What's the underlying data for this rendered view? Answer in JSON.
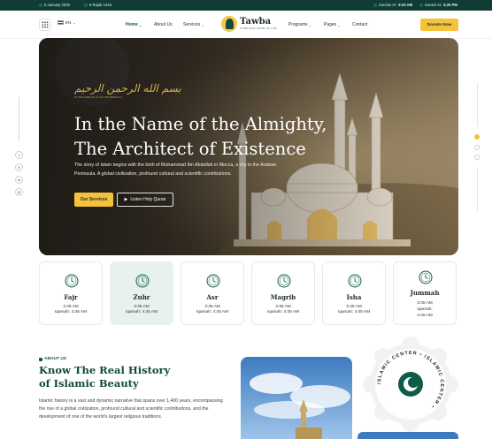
{
  "topbar": {
    "date_greg": "5 January 2025",
    "date_hijri": "6 Rajab 1446",
    "sunrise_label": "Sunrise At:",
    "sunrise_time": "6:20 AM",
    "sunset_label": "Sunset At:",
    "sunset_time": "5:20 PM"
  },
  "header": {
    "lang": "EN",
    "logo_title": "Tawba",
    "logo_tagline": "COMPLETE CODE OF LIFE",
    "nav": {
      "home": "Home",
      "about": "About Us",
      "services": "Services",
      "programs": "Programs",
      "pages": "Pages",
      "contact": "Contact"
    },
    "donate": "Donate Now"
  },
  "social": {
    "facebook": "f",
    "x": "X",
    "linkedin": "in",
    "instagram": "◎"
  },
  "hero": {
    "calligraphy": "بسم الله الرحمن الرحيم",
    "calligraphy_sub": "IN THE NAME OF ALLAH THE MERCIFUL",
    "title_line1": "In the Name of the Almighty,",
    "title_line2": "The Architect of Existence",
    "text": "The story of Islam begins with the birth of Muhammad Ibn Abdullah in Mecca, a city in the Arabian Peninsula. A global civilization, profound cultural and scientific contributions.",
    "btn_primary": "Our Services",
    "btn_secondary": "Listen Holy Quran"
  },
  "prayers": [
    {
      "name": "Fajr",
      "time": "3:45 AM",
      "iqamah": "Iqamah: 4:45 AM"
    },
    {
      "name": "Zuhr",
      "time": "3:45 AM",
      "iqamah": "Iqamah: 4:45 AM"
    },
    {
      "name": "Asr",
      "time": "3:45 AM",
      "iqamah": "Iqamah: 4:45 AM"
    },
    {
      "name": "Magrib",
      "time": "3:45 AM",
      "iqamah": "Iqamah: 4:45 AM"
    },
    {
      "name": "Isha",
      "time": "3:45 AM",
      "iqamah": "Iqamah: 4:45 AM"
    },
    {
      "name": "Jummah",
      "time": "3:45 AM",
      "iqamah": "Iqamah:",
      "extra": "4:45 AM"
    }
  ],
  "about": {
    "tag": "ABOUT US",
    "title_line1": "Know The Real History",
    "title_line2": "of Islamic Beauty",
    "text": "Islamic history is a vast and dynamic narrative that spans over 1,400 years, encompassing the rise of a global civilization, profound cultural and scientific contributions, and the development of one of the world's largest religious traditions.",
    "badge_text": "ISLAMIC CENTER • ISLAMIC CENTER •"
  },
  "colors": {
    "primary": "#0f5b49",
    "accent": "#f5c33b",
    "dark": "#0f3d35"
  }
}
